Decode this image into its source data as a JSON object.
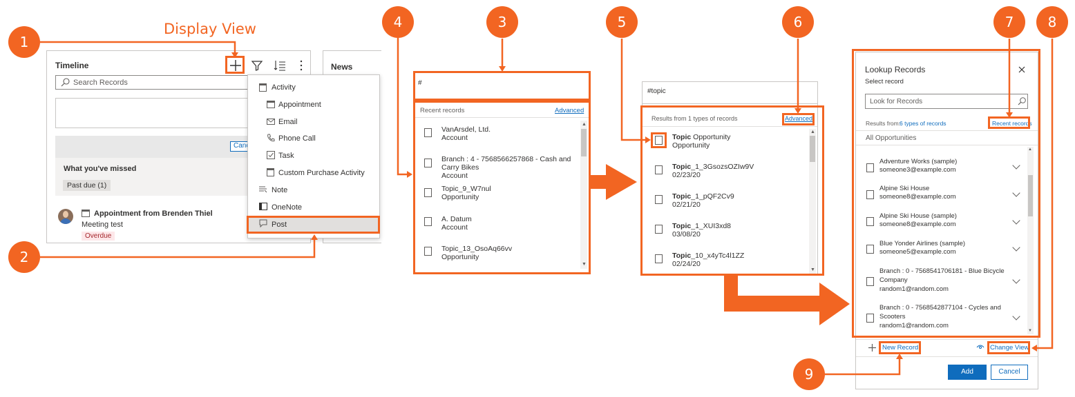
{
  "labels": {
    "display_view": "Display View"
  },
  "badges": [
    "1",
    "2",
    "3",
    "4",
    "5",
    "6",
    "7",
    "8",
    "9"
  ],
  "timeline": {
    "title": "Timeline",
    "news_label": "News",
    "search_placeholder": "Search Records",
    "cancel_button": "Canc",
    "whats_missed": "What you've missed",
    "past_due": "Past due (1)",
    "appointment_title": "Appointment from Brenden Thiel",
    "appointment_subtitle": "Meeting test",
    "overdue_badge": "Overdue",
    "menu": [
      {
        "label": "Activity",
        "icon": "activity-icon"
      },
      {
        "label": "Appointment",
        "icon": "calendar-icon"
      },
      {
        "label": "Email",
        "icon": "email-icon"
      },
      {
        "label": "Phone Call",
        "icon": "phone-icon"
      },
      {
        "label": "Task",
        "icon": "task-icon"
      },
      {
        "label": "Custom Purchase Activity",
        "icon": "activity-icon"
      },
      {
        "label": "Note",
        "icon": "note-icon"
      },
      {
        "label": "OneNote",
        "icon": "onenote-icon"
      },
      {
        "label": "Post",
        "icon": "post-icon"
      }
    ]
  },
  "recent_panel": {
    "input_value": "#",
    "header": "Recent records",
    "advanced_link": "Advanced",
    "records": [
      {
        "title": "VanArsdel, Ltd.",
        "subtitle": "Account"
      },
      {
        "title": "Branch : 4 - 7568566257868 - Cash and",
        "title2": "Carry Bikes",
        "subtitle": "Account"
      },
      {
        "title": "Topic_9_W7nul",
        "subtitle": "Opportunity"
      },
      {
        "title": "A. Datum",
        "subtitle": "Account"
      },
      {
        "title": "Topic_13_OsoAq66vv",
        "subtitle": "Opportunity"
      }
    ]
  },
  "topic_panel": {
    "input_value": "#topic",
    "results_text": "Results from 1 types of records",
    "advanced_link": "Advanced",
    "records": [
      {
        "bold": "Topic",
        "rest": " Opportunity",
        "subtitle": "Opportunity"
      },
      {
        "bold": "Topic",
        "rest": "_1_3GsozsOZIw9V",
        "subtitle": "02/23/20"
      },
      {
        "bold": "Topic",
        "rest": "_1_pQF2Cv9",
        "subtitle": "02/21/20"
      },
      {
        "bold": "Topic",
        "rest": "_1_XUI3xd8",
        "subtitle": "03/08/20"
      },
      {
        "bold": "Topic",
        "rest": "_10_x4yTc4l1ZZ",
        "subtitle": "02/24/20"
      }
    ]
  },
  "lookup": {
    "title": "Lookup Records",
    "select_label": "Select record",
    "search_placeholder": "Look for Records",
    "results_from_label": "Results from:",
    "types_link": "6 types of records",
    "recent_records_link": "Recent records",
    "view_label": "All Opportunities",
    "records": [
      {
        "lines": [
          "Adventure Works (sample)"
        ],
        "email": "someone3@example.com"
      },
      {
        "lines": [
          "Alpine Ski House"
        ],
        "email": "someone8@example.com"
      },
      {
        "lines": [
          "Alpine Ski House (sample)"
        ],
        "email": "someone8@example.com"
      },
      {
        "lines": [
          "Blue Yonder Airlines (sample)"
        ],
        "email": "someone5@example.com"
      },
      {
        "lines": [
          "Branch : 0 - 7568541706181 - Blue Bicycle",
          "Company"
        ],
        "email": "random1@random.com"
      },
      {
        "lines": [
          "Branch : 0 - 7568542877104 - Cycles and",
          "Scooters"
        ],
        "email": "random1@random.com"
      }
    ],
    "new_record": "New Record",
    "change_view": "Change View",
    "add_button": "Add",
    "cancel_button": "Cancel"
  },
  "colors": {
    "accent": "#f26522",
    "link": "#0f6cbd",
    "primary_button": "#0f6cbd"
  }
}
